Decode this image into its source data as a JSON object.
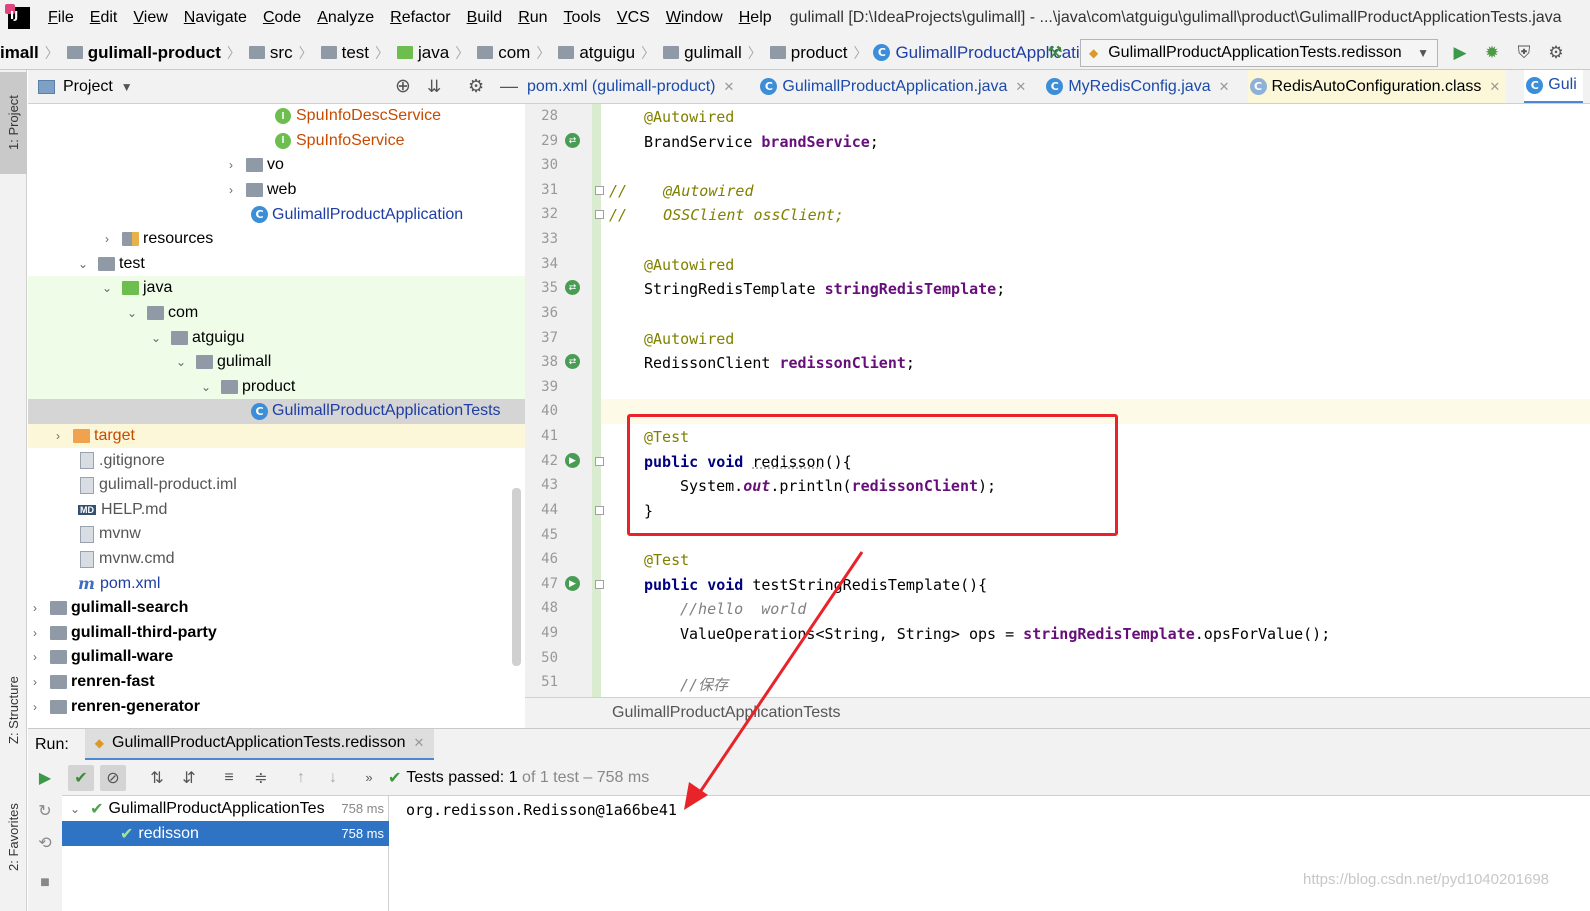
{
  "menubar": {
    "items": [
      "File",
      "Edit",
      "View",
      "Navigate",
      "Code",
      "Analyze",
      "Refactor",
      "Build",
      "Run",
      "Tools",
      "VCS",
      "Window",
      "Help"
    ],
    "title": "gulimall [D:\\IdeaProjects\\gulimall] - ...\\java\\com\\atguigu\\gulimall\\product\\GulimallProductApplicationTests.java"
  },
  "navbar": {
    "crumbs": [
      "imall",
      "gulimall-product",
      "src",
      "test",
      "java",
      "com",
      "atguigu",
      "gulimall",
      "product",
      "GulimallProductApplicationTests"
    ],
    "run_config": "GulimallProductApplicationTests.redisson"
  },
  "side_tabs": {
    "project": "1: Project",
    "structure": "Z: Structure",
    "favorites": "2: Favorites"
  },
  "project_panel": {
    "title": "Project",
    "tree": [
      {
        "label": "SpuInfoDescService",
        "kind": "interface"
      },
      {
        "label": "SpuInfoService",
        "kind": "interface"
      },
      {
        "label": "vo",
        "kind": "folder"
      },
      {
        "label": "web",
        "kind": "folder"
      },
      {
        "label": "GulimallProductApplication",
        "kind": "class"
      },
      {
        "label": "resources",
        "kind": "folder"
      },
      {
        "label": "test",
        "kind": "folder"
      },
      {
        "label": "java",
        "kind": "folder"
      },
      {
        "label": "com",
        "kind": "folder"
      },
      {
        "label": "atguigu",
        "kind": "folder"
      },
      {
        "label": "gulimall",
        "kind": "folder"
      },
      {
        "label": "product",
        "kind": "folder"
      },
      {
        "label": "GulimallProductApplicationTests",
        "kind": "class"
      },
      {
        "label": "target",
        "kind": "folder"
      },
      {
        "label": ".gitignore",
        "kind": "file"
      },
      {
        "label": "gulimall-product.iml",
        "kind": "file"
      },
      {
        "label": "HELP.md",
        "kind": "md"
      },
      {
        "label": "mvnw",
        "kind": "file"
      },
      {
        "label": "mvnw.cmd",
        "kind": "file"
      },
      {
        "label": "pom.xml",
        "kind": "maven"
      },
      {
        "label": "gulimall-search",
        "kind": "module"
      },
      {
        "label": "gulimall-third-party",
        "kind": "module"
      },
      {
        "label": "gulimall-ware",
        "kind": "module"
      },
      {
        "label": "renren-fast",
        "kind": "module"
      },
      {
        "label": "renren-generator",
        "kind": "module"
      }
    ]
  },
  "editor_tabs": [
    {
      "label": "pom.xml (gulimall-product)"
    },
    {
      "label": "GulimallProductApplication.java"
    },
    {
      "label": "MyRedisConfig.java"
    },
    {
      "label": "RedisAutoConfiguration.class"
    },
    {
      "label": "Guli"
    }
  ],
  "editor": {
    "line_numbers": [
      "28",
      "29",
      "30",
      "31",
      "32",
      "33",
      "34",
      "35",
      "36",
      "37",
      "38",
      "39",
      "40",
      "41",
      "42",
      "43",
      "44",
      "45",
      "46",
      "47",
      "48",
      "49",
      "50",
      "51"
    ],
    "lines": {
      "l28": "@Autowired",
      "l29_type": "BrandService ",
      "l29_field": "brandService",
      "l31": "//    @Autowired",
      "l32": "//    OSSClient ossClient;",
      "l34": "@Autowired",
      "l35_type": "StringRedisTemplate ",
      "l35_field": "stringRedisTemplate",
      "l37": "@Autowired",
      "l38_type": "RedissonClient ",
      "l38_field": "redissonClient",
      "l41": "@Test",
      "l42_kw": "public void ",
      "l42_name": "redisson",
      "l42_rest": "(){",
      "l43_a": "System.",
      "l43_out": "out",
      "l43_b": ".println(",
      "l43_field": "redissonClient",
      "l43_c": ");",
      "l44": "}",
      "l46": "@Test",
      "l47_kw": "public void ",
      "l47_rest": "testStringRedisTemplate(){",
      "l48": "//hello  world",
      "l49_a": "ValueOperations<String, String> ops = ",
      "l49_field": "stringRedisTemplate",
      "l49_b": ".opsForValue();",
      "l51": "//保存"
    },
    "breadcrumb": "GulimallProductApplicationTests"
  },
  "run_panel": {
    "label": "Run:",
    "tab": "GulimallProductApplicationTests.redisson",
    "status_prefix": "Tests passed:",
    "status_count": "1",
    "status_suffix": "of 1 test – 758 ms",
    "tests": [
      {
        "name": "GulimallProductApplicationTes",
        "time": "758 ms"
      },
      {
        "name": "redisson",
        "time": "758 ms"
      }
    ],
    "console_output": "org.redisson.Redisson@1a66be41"
  },
  "watermark": "https://blog.csdn.net/pyd1040201698",
  "colors": {
    "accent": "#4a88d6",
    "highlight_box": "#e8242a",
    "selection": "#2f73c5"
  }
}
